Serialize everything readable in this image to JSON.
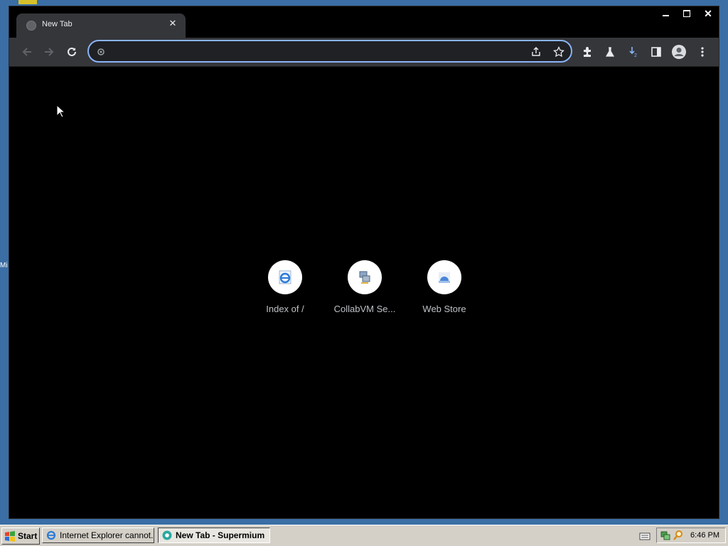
{
  "browser": {
    "tab_title": "New Tab",
    "omnibox_value": "",
    "shortcuts": [
      {
        "label": "Index of /"
      },
      {
        "label": "CollabVM Se..."
      },
      {
        "label": "Web Store"
      }
    ]
  },
  "taskbar": {
    "start_label": "Start",
    "tasks": [
      {
        "label": "Internet Explorer cannot..."
      },
      {
        "label": "New Tab - Supermium"
      }
    ],
    "clock": "6:46 PM"
  },
  "desktop": {
    "partial_icon_label": "Mi"
  },
  "colors": {
    "accent": "#8ab4f8",
    "toolbar": "#35363a",
    "taskbar": "#d4d0c8",
    "desktop": "#3a6ea5"
  }
}
